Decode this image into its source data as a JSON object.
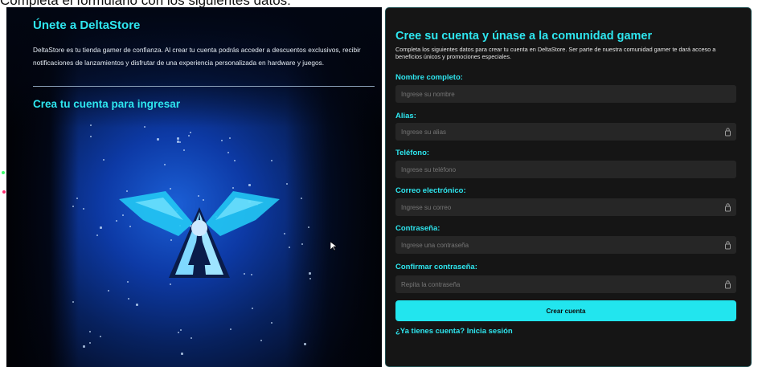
{
  "caption": "Completa el formulario con los siguientes datos:",
  "left_panel": {
    "title": "Únete a DeltaStore",
    "description": "DeltaStore es tu tienda gamer de confianza. Al crear tu cuenta podrás acceder a descuentos exclusivos, recibir notificaciones de lanzamientos y disfrutar de una experiencia personalizada en hardware y juegos.",
    "subtitle": "Crea tu cuenta para ingresar"
  },
  "form": {
    "title": "Cree su cuenta y únase a la comunidad gamer",
    "description": "Completa los siguientes datos para crear tu cuenta en DeltaStore. Ser parte de nuestra comunidad gamer te dará acceso a beneficios únicos y promociones especiales.",
    "fields": [
      {
        "label": "Nombre completo:",
        "placeholder": "Ingrese su nombre",
        "icon": null
      },
      {
        "label": "Alias:",
        "placeholder": "Ingrese su alias",
        "icon": "lock-icon"
      },
      {
        "label": "Teléfono:",
        "placeholder": "Ingrese su teléfono",
        "icon": null
      },
      {
        "label": "Correo electrónico:",
        "placeholder": "Ingrese su correo",
        "icon": "lock-icon"
      },
      {
        "label": "Contraseña:",
        "placeholder": "Ingrese una contraseña",
        "icon": "lock-icon"
      },
      {
        "label": "Confirmar contraseña:",
        "placeholder": "Repita la contraseña",
        "icon": "lock-icon"
      }
    ],
    "submit_label": "Crear cuenta",
    "login_link": "¿Ya tienes cuenta? Inicia sesión"
  },
  "colors": {
    "accent": "#2ee6ef",
    "button": "#22e5ee",
    "panel_bg": "#151515",
    "field_bg": "#262626"
  }
}
